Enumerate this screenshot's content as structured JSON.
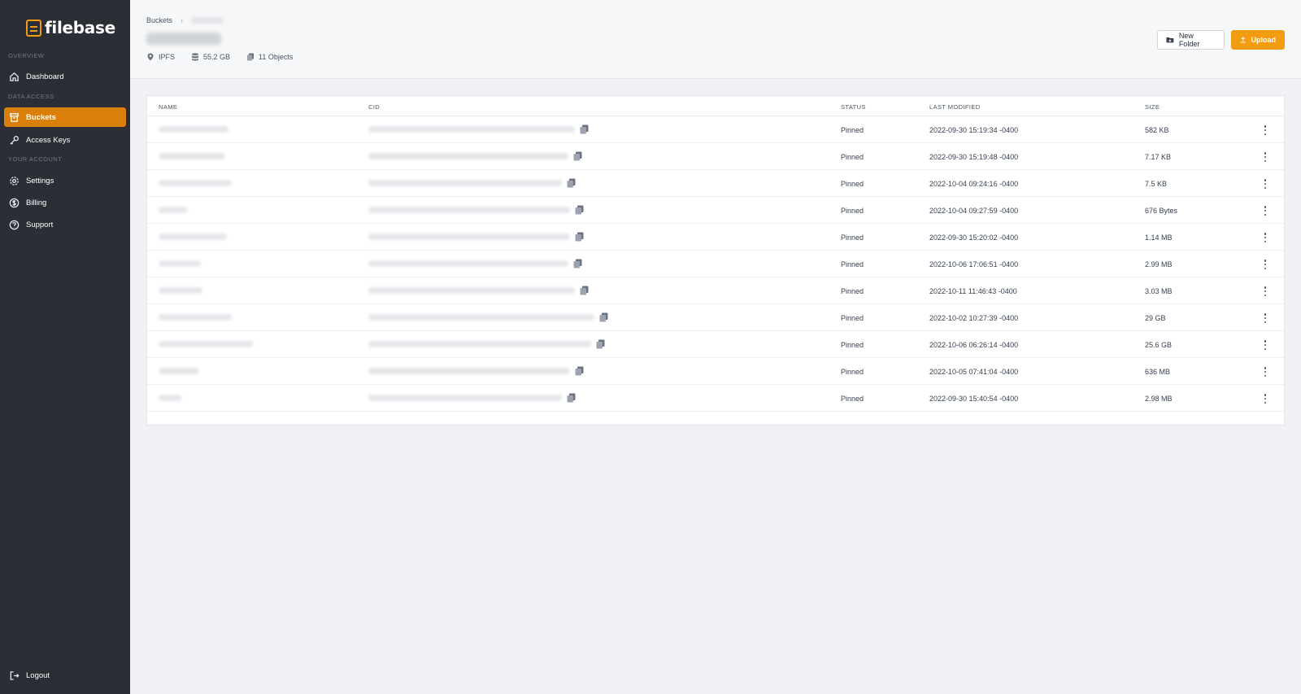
{
  "sidebar": {
    "brand": "filebase",
    "sections": {
      "overview": "OVERVIEW",
      "data_access": "DATA ACCESS",
      "your_account": "YOUR ACCOUNT"
    },
    "items": {
      "dashboard": "Dashboard",
      "buckets": "Buckets",
      "access_keys": "Access Keys",
      "settings": "Settings",
      "billing": "Billing",
      "support": "Support",
      "logout": "Logout"
    },
    "active_item": "Buckets",
    "accent_color": "#d97f0a"
  },
  "header": {
    "breadcrumb_root": "Buckets",
    "meta": {
      "network": "IPFS",
      "storage": "55.2 GB",
      "objects": "11 Objects"
    },
    "new_folder_label": "New Folder",
    "upload_label": "Upload",
    "upload_color": "#f39c12"
  },
  "table": {
    "columns": {
      "name": "NAME",
      "cid": "CID",
      "status": "STATUS",
      "last_modified": "LAST MODIFIED",
      "size": "SIZE"
    },
    "rows": [
      {
        "status": "Pinned",
        "modified": "2022-09-30 15:19:34 -0400",
        "size": "582 KB"
      },
      {
        "status": "Pinned",
        "modified": "2022-09-30 15:19:48 -0400",
        "size": "7.17 KB"
      },
      {
        "status": "Pinned",
        "modified": "2022-10-04 09:24:16 -0400",
        "size": "7.5 KB"
      },
      {
        "status": "Pinned",
        "modified": "2022-10-04 09:27:59 -0400",
        "size": "676 Bytes"
      },
      {
        "status": "Pinned",
        "modified": "2022-09-30 15:20:02 -0400",
        "size": "1.14 MB"
      },
      {
        "status": "Pinned",
        "modified": "2022-10-06 17:06:51 -0400",
        "size": "2.99 MB"
      },
      {
        "status": "Pinned",
        "modified": "2022-10-11 11:46:43 -0400",
        "size": "3.03 MB"
      },
      {
        "status": "Pinned",
        "modified": "2022-10-02 10:27:39 -0400",
        "size": "29 GB"
      },
      {
        "status": "Pinned",
        "modified": "2022-10-06 06:26:14 -0400",
        "size": "25.6 GB"
      },
      {
        "status": "Pinned",
        "modified": "2022-10-05 07:41:04 -0400",
        "size": "636 MB"
      },
      {
        "status": "Pinned",
        "modified": "2022-09-30 15:40:54 -0400",
        "size": "2.98 MB"
      }
    ]
  }
}
